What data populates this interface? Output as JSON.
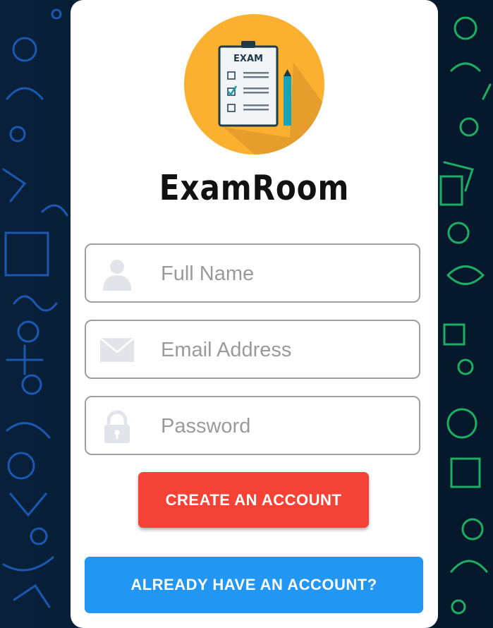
{
  "app": {
    "title": "ExamRoom",
    "logo_text": "EXAM"
  },
  "form": {
    "full_name": {
      "placeholder": "Full Name",
      "value": ""
    },
    "email": {
      "placeholder": "Email Address",
      "value": ""
    },
    "password": {
      "placeholder": "Password",
      "value": ""
    }
  },
  "buttons": {
    "create_account": "CREATE AN ACCOUNT",
    "have_account": "ALREADY HAVE AN ACCOUNT?"
  },
  "colors": {
    "background": "#071a2e",
    "doodle_blue": "#1e6bd6",
    "doodle_green": "#1fc46a",
    "logo_circle": "#fbb12f",
    "create_button": "#f44336",
    "login_button": "#2196f3",
    "icon_gray": "#e1e5ea"
  },
  "icons": {
    "full_name": "user-icon",
    "email": "envelope-icon",
    "password": "lock-icon"
  }
}
